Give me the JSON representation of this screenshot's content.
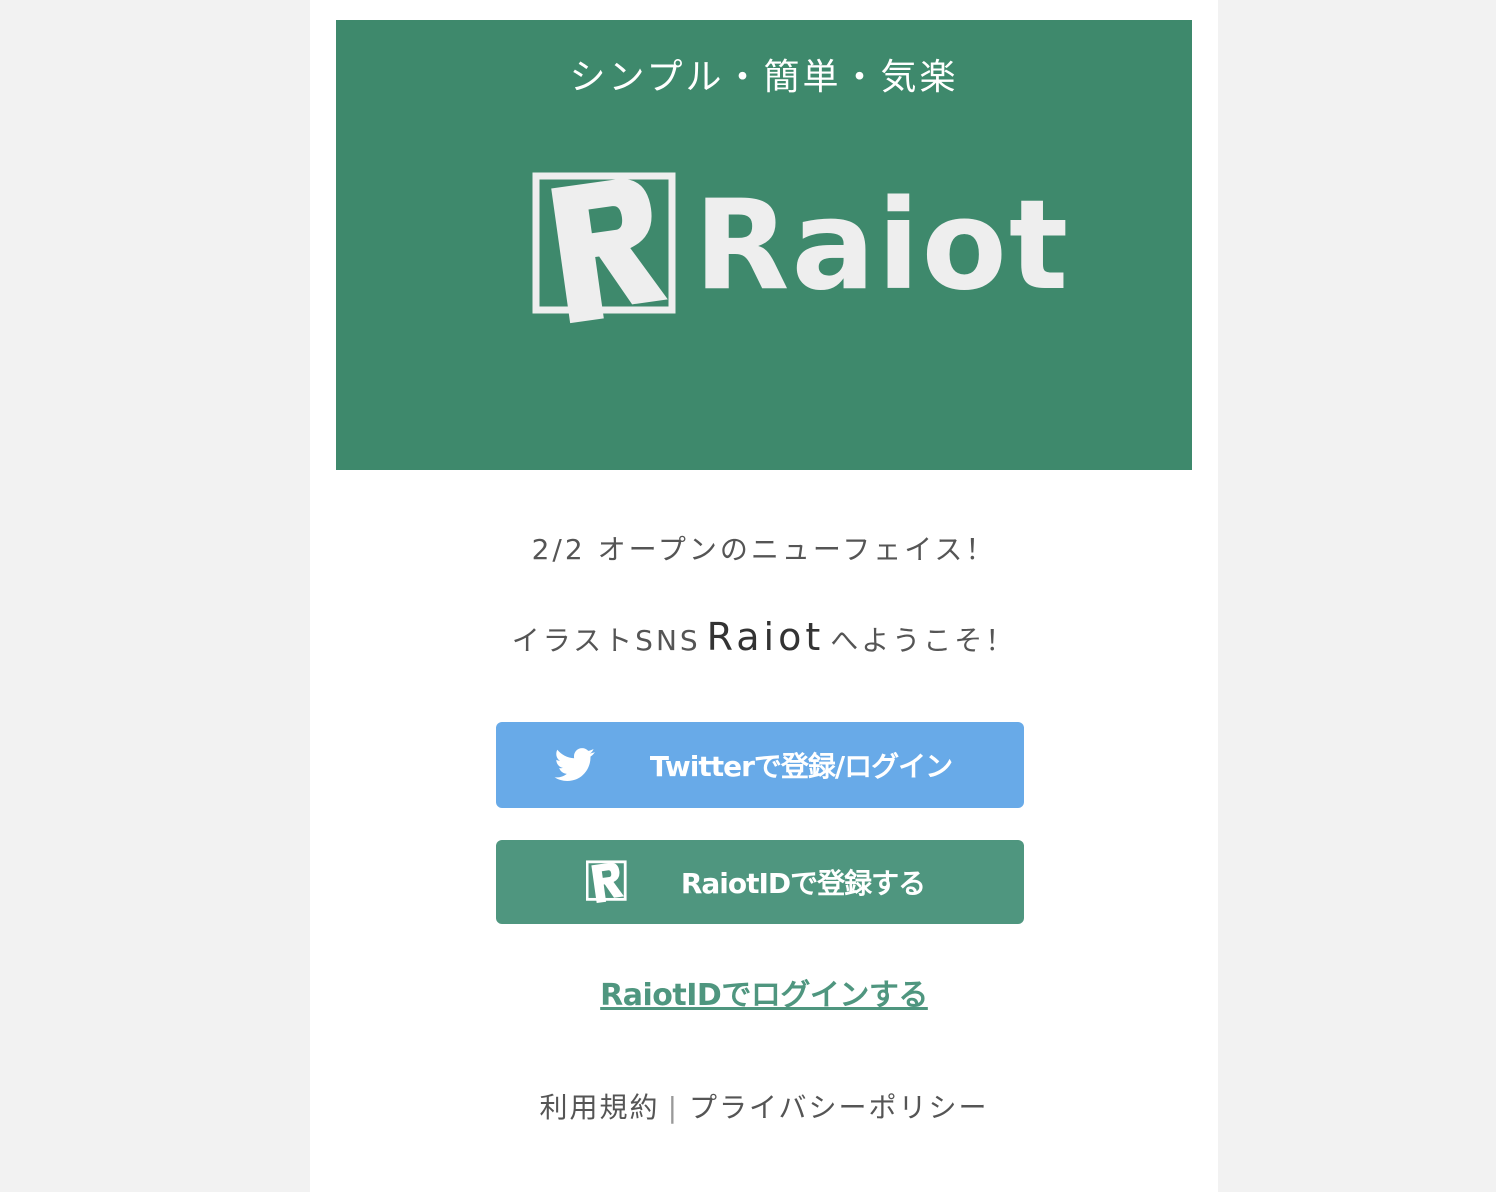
{
  "hero": {
    "tagline": "シンプル・簡単・気楽",
    "logo_text": "Raiot",
    "logo_mark_letter": "R"
  },
  "intro": {
    "line1": "2/2 オープンのニューフェイス！",
    "line2_prefix": "イラストSNS",
    "line2_brand": "Raiot",
    "line2_suffix": "へようこそ！"
  },
  "buttons": {
    "twitter_label": "Twitterで登録/ログイン",
    "raiot_register_label": "RaiotIDで登録する"
  },
  "login_link": "RaiotIDでログインする",
  "footer": {
    "terms": "利用規約",
    "separator": "|",
    "privacy": "プライバシーポリシー"
  },
  "colors": {
    "page_background": "#f2f2f2",
    "hero_green": "#3e896c",
    "twitter_blue": "#68aae8",
    "raiot_green": "#4f967f"
  },
  "icons": {
    "twitter_button_icon": "twitter-bird-icon",
    "raiot_button_icon": "raiot-logo-icon"
  }
}
